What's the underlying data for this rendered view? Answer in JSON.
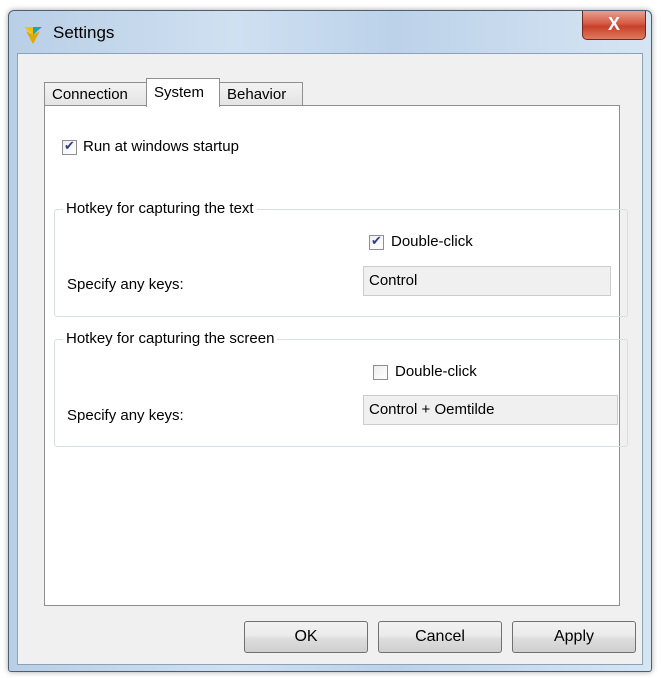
{
  "window": {
    "title": "Settings",
    "close_glyph": "X"
  },
  "tabs": [
    {
      "label": "Connection",
      "active": false
    },
    {
      "label": "System",
      "active": true
    },
    {
      "label": "Behavior",
      "active": false
    }
  ],
  "system": {
    "run_at_startup": {
      "label": "Run at windows startup",
      "checked": true
    },
    "text_hotkey": {
      "title": "Hotkey for capturing  the text",
      "double_click": {
        "label": "Double-click",
        "checked": true
      },
      "keys_label": "Specify any keys:",
      "keys_value": "Control"
    },
    "screen_hotkey": {
      "title": "Hotkey for capturing the screen",
      "double_click": {
        "label": "Double-click",
        "checked": false
      },
      "keys_label": "Specify any keys:",
      "keys_value": "Control + Oemtilde"
    }
  },
  "buttons": {
    "ok": "OK",
    "cancel": "Cancel",
    "apply": "Apply"
  },
  "colors": {
    "app_icon_yellow": "#f2c200",
    "app_icon_teal": "#1aa6b3",
    "close_red": "#c7402a",
    "check_mark": "#2a3f8f"
  }
}
